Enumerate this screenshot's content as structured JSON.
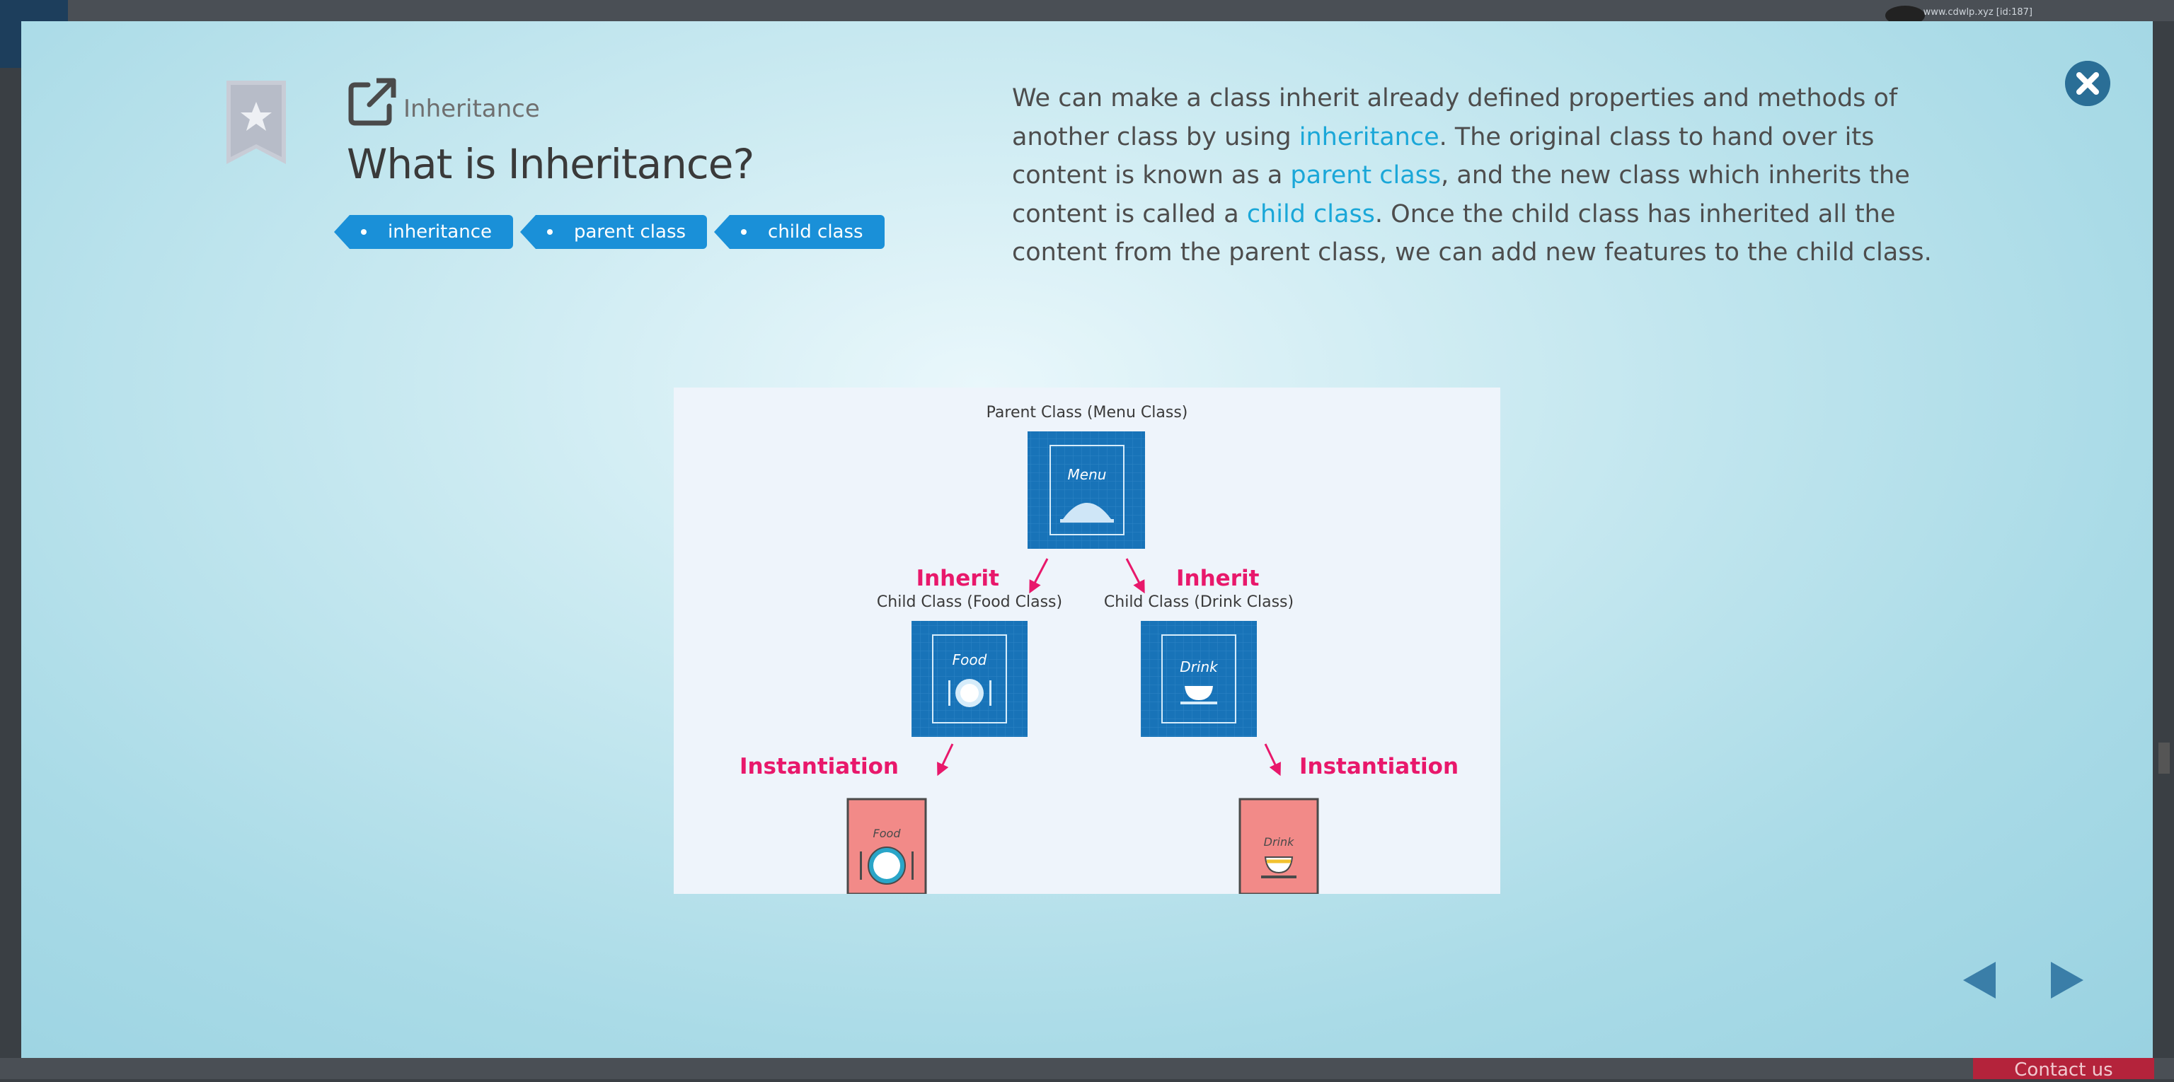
{
  "background": {
    "user_info": "www.cdwlp.xyz [id:187]",
    "contact_label": "Contact us"
  },
  "modal": {
    "topic": "Inheritance",
    "title": "What is Inheritance?",
    "tags": [
      "inheritance",
      "parent class",
      "child class"
    ],
    "description": {
      "t1": "We can make a class inherit already defined properties and methods of another class by using ",
      "l1": "inheritance",
      "t2": ". The original class to hand over its content is known as a ",
      "l2": "parent class",
      "t3": ", and the new class which inherits the content is called a ",
      "l3": "child class",
      "t4": ". Once the child class has inherited all the content from the parent class, we can add new features to the child class."
    },
    "figure": {
      "parent_label": "Parent Class (Menu Class)",
      "menu_text": "Menu",
      "inherit_left": "Inherit",
      "inherit_right": "Inherit",
      "child_food_label": "Child Class (Food Class)",
      "child_drink_label": "Child Class (Drink Class)",
      "food_text": "Food",
      "drink_text": "Drink",
      "instantiation_left": "Instantiation",
      "instantiation_right": "Instantiation",
      "food_instance_text": "Food",
      "drink_instance_text": "Drink"
    },
    "colors": {
      "accent": "#1a90d8",
      "link": "#1aa7d8",
      "arrow": "#e8186b",
      "class_box": "#1873b8",
      "instance_box": "#f28a88"
    }
  }
}
